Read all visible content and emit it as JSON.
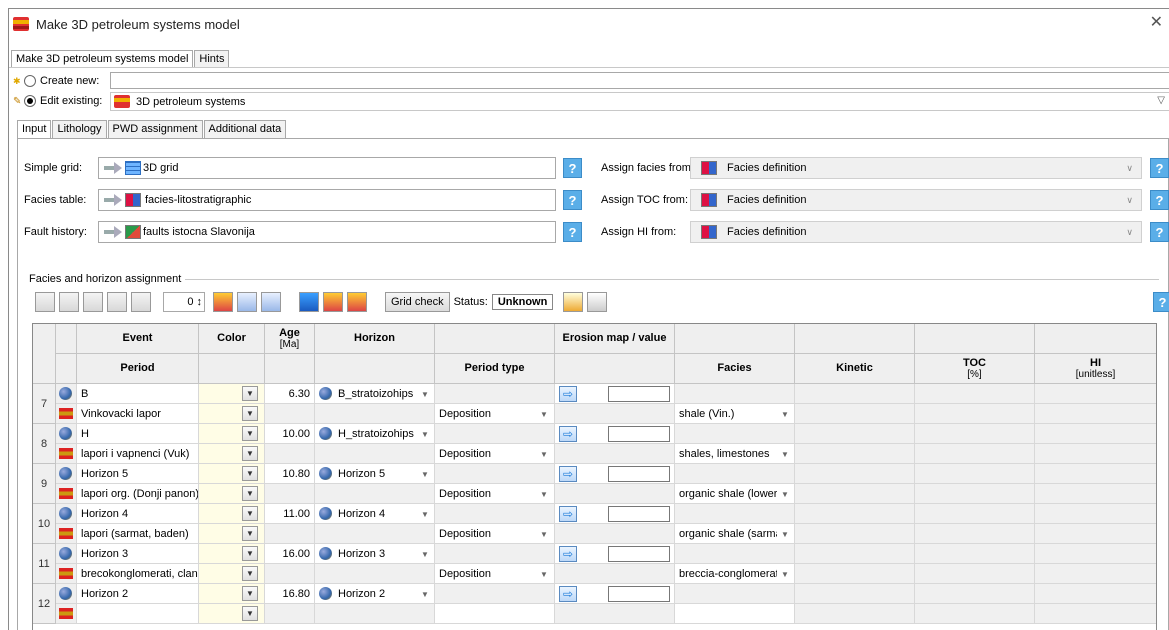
{
  "window": {
    "title": "Make 3D petroleum systems model"
  },
  "top_tabs": [
    "Make 3D petroleum systems model",
    "Hints"
  ],
  "create_new": {
    "label": "Create new:",
    "value": ""
  },
  "edit_existing": {
    "label": "Edit existing:",
    "value": "3D petroleum systems"
  },
  "inner_tabs": [
    "Input",
    "Lithology",
    "PWD assignment",
    "Additional data"
  ],
  "inputs": {
    "simple_grid": {
      "label": "Simple grid:",
      "value": "3D grid"
    },
    "facies_table": {
      "label": "Facies table:",
      "value": "facies-litostratigraphic"
    },
    "fault_history": {
      "label": "Fault history:",
      "value": "faults istocna Slavonija"
    },
    "assign_facies": {
      "label": "Assign facies from:",
      "value": "Facies definition"
    },
    "assign_toc": {
      "label": "Assign TOC from:",
      "value": "Facies definition"
    },
    "assign_hi": {
      "label": "Assign HI from:",
      "value": "Facies definition"
    }
  },
  "section": {
    "title": "Facies and horizon assignment"
  },
  "toolbar": {
    "spinner_value": "0",
    "grid_check_label": "Grid check",
    "status_label": "Status:",
    "status_value": "Unknown"
  },
  "table": {
    "headers_row1": {
      "event": "Event",
      "color": "Color",
      "age": "Age",
      "age_unit": "[Ma]",
      "horizon": "Horizon",
      "erosion": "Erosion map / value"
    },
    "headers_row2": {
      "period": "Period",
      "period_type": "Period type",
      "facies": "Facies",
      "kinetic": "Kinetic",
      "toc": "TOC",
      "toc_unit": "[%]",
      "hi": "HI",
      "hi_unit": "[unitless]"
    },
    "rows": [
      {
        "num": "7",
        "event": "B",
        "age": "6.30",
        "horizon": "B_stratoizohips",
        "period": "Vinkovacki lapor",
        "period_type": "Deposition",
        "facies": "shale (Vin.)"
      },
      {
        "num": "8",
        "event": "H",
        "age": "10.00",
        "horizon": "H_stratoizohips",
        "period": "lapori i vapnenci (Vuk)",
        "period_type": "Deposition",
        "facies": "shales, limestones"
      },
      {
        "num": "9",
        "event": "Horizon 5",
        "age": "10.80",
        "horizon": "Horizon 5",
        "period": "lapori org. (Donji panon)",
        "period_type": "Deposition",
        "facies": "organic shale (lower"
      },
      {
        "num": "10",
        "event": "Horizon 4",
        "age": "11.00",
        "horizon": "Horizon 4",
        "period": "lapori (sarmat, baden)",
        "period_type": "Deposition",
        "facies": "organic shale (sarma"
      },
      {
        "num": "11",
        "event": "Horizon 3",
        "age": "16.00",
        "horizon": "Horizon 3",
        "period": "brecokonglomerati, clan l",
        "period_type": "Deposition",
        "facies": "breccia-conglomerat"
      },
      {
        "num": "12",
        "event": "Horizon 2",
        "age": "16.80",
        "horizon": "Horizon 2",
        "period": "",
        "period_type": "",
        "facies": ""
      }
    ]
  },
  "colors": {
    "accent": "#5aaee8",
    "header_bg": "#efefef",
    "color_cell": "#fffde6"
  }
}
